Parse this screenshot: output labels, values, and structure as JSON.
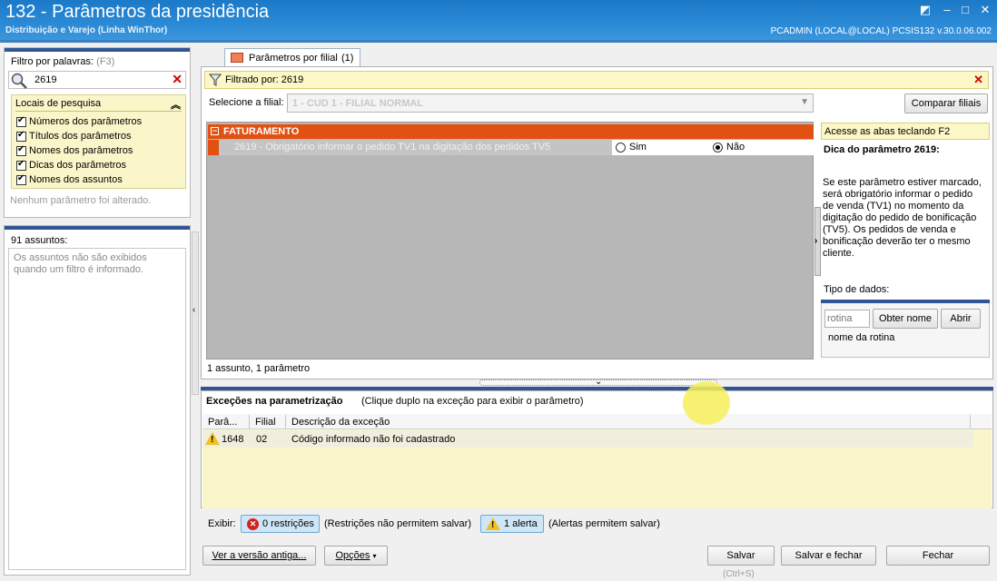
{
  "window": {
    "title": "132 - Parâmetros da presidência",
    "subtitle": "Distribuição e Varejo (Linha WinThor)",
    "user_info": "PCADMIN (LOCAL@LOCAL)   PCSIS132  v.30.0.06.002",
    "accent": "#2f5597"
  },
  "filter": {
    "label": "Filtro por palavras:",
    "shortcut": "(F3)",
    "search_value": "2619",
    "locais_title": "Locais de pesquisa",
    "locais": [
      "Números dos parâmetros",
      "Títulos dos parâmetros",
      "Nomes dos parâmetros",
      "Dicas dos parâmetros",
      "Nomes dos assuntos"
    ],
    "status": "Nenhum parâmetro foi alterado."
  },
  "subjects": {
    "count_label": "91 assuntos:",
    "note": "Os assuntos não são exibidos quando um filtro é informado."
  },
  "tab": {
    "label": "Parâmetros por filial",
    "count": "(1)"
  },
  "filtered": {
    "text": "Filtrado por: 2619"
  },
  "filial": {
    "label": "Selecione a filial:",
    "value": "1 - CUD 1 - FILIAL NORMAL",
    "compare_button": "Comparar filiais"
  },
  "params": {
    "group_title": "FATURAMENTO",
    "row_text": "2619 - Obrigatório informar o pedido TV1 na digitação dos pedidos TV5",
    "option_yes": "Sim",
    "option_no": "Não",
    "selected": "Não",
    "summary": "1 assunto, 1 parâmetro"
  },
  "tip": {
    "hint": "Acesse as abas teclando F2",
    "title": "Dica do parâmetro 2619:",
    "text": "Se este parâmetro estiver marcado, será obrigatório informar o pedido de venda (TV1) no momento da digitação do pedido de bonificação (TV5). Os pedidos de venda e bonificação deverão ter o mesmo cliente.",
    "data_type_label": "Tipo de dados:",
    "rotina_placeholder": "rotina",
    "get_name_button": "Obter nome",
    "open_button": "Abrir",
    "rotina_name_label": "nome da rotina"
  },
  "exceptions": {
    "title": "Exceções na parametrização",
    "hint": "(Clique duplo na exceção para exibir o parâmetro)",
    "columns": [
      "Parâ...",
      "Filial",
      "Descrição da exceção"
    ],
    "rows": [
      {
        "param": "1648",
        "filial": "02",
        "description": "Código informado não foi cadastrado"
      }
    ],
    "show_label": "Exibir:",
    "restrictions_button": "0 restrições",
    "restrictions_note": "(Restrições não permitem salvar)",
    "alerts_button": "1 alerta",
    "alerts_note": "(Alertas permitem salvar)"
  },
  "footer": {
    "old_version_button": "Ver a versão antiga...",
    "options_button": "Opções",
    "save_button": "Salvar",
    "save_shortcut": "(Ctrl+S)",
    "save_close_button": "Salvar e fechar",
    "close_button": "Fechar"
  }
}
